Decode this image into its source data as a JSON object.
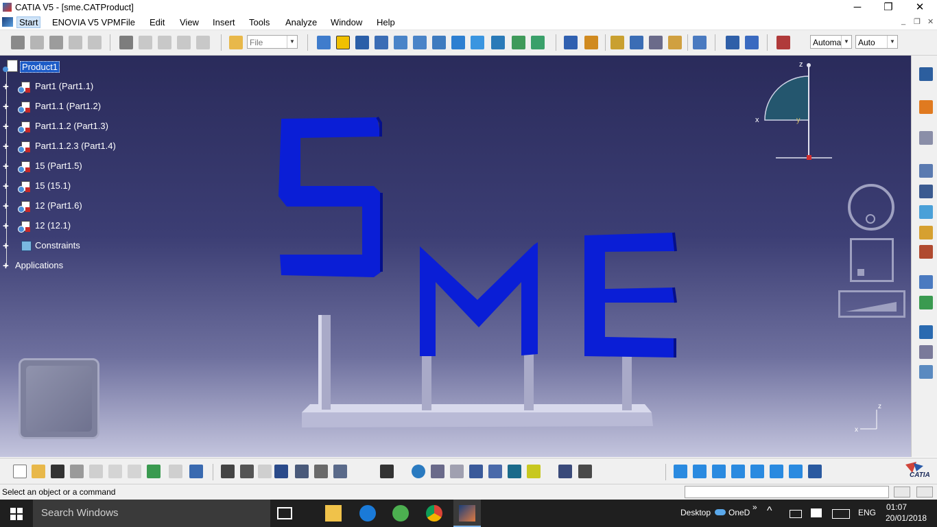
{
  "window": {
    "title": "CATIA V5 - [sme.CATProduct]",
    "controls": [
      "─",
      "❐",
      "✕"
    ],
    "mdi_controls": [
      "_",
      "❐",
      "✕"
    ]
  },
  "menubar": {
    "items": [
      "Start",
      "ENOVIA V5 VPM",
      "File",
      "Edit",
      "View",
      "Insert",
      "Tools",
      "Analyze",
      "Window",
      "Help"
    ]
  },
  "toolbar": {
    "file_combo": "File",
    "render_combo": "Automa",
    "lod_combo": "Auto"
  },
  "tree": {
    "root": "Product1",
    "items": [
      "Part1 (Part1.1)",
      "Part1.1 (Part1.2)",
      "Part1.1.2 (Part1.3)",
      "Part1.1.2.3 (Part1.4)",
      "15 (Part1.5)",
      "15 (15.1)",
      "12 (Part1.6)",
      "12 (12.1)"
    ],
    "constraints": "Constraints",
    "applications": "Applications"
  },
  "compass": {
    "x": "x",
    "y": "y",
    "z": "z"
  },
  "axis_triad": {
    "x": "x",
    "z": "z"
  },
  "model": {
    "letters": [
      "S",
      "M",
      "E"
    ],
    "letter_color": "#0a1ed6"
  },
  "statusbar": {
    "message": "Select an object or a command"
  },
  "taskbar": {
    "search_placeholder": "Search Windows",
    "tray_desktop": "Desktop",
    "tray_onedrive": "OneD",
    "tray_chevron": "»",
    "tray_lang": "ENG",
    "clock_time": "01:07",
    "clock_date": "20/01/2018"
  },
  "brand": {
    "logo_text": "CATIA"
  }
}
